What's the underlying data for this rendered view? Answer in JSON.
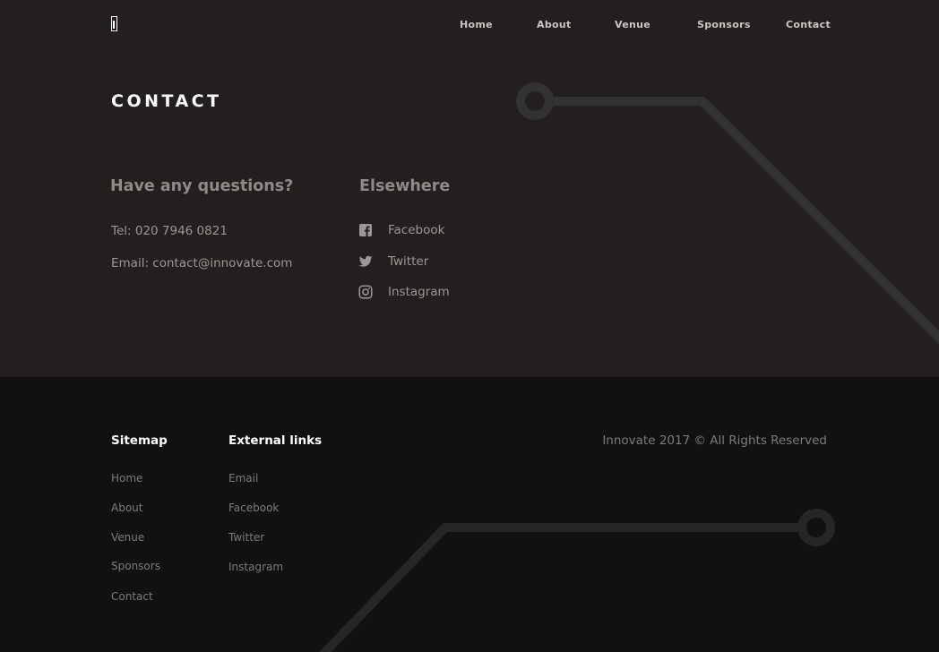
{
  "header": {
    "nav": [
      {
        "label": "Home"
      },
      {
        "label": "About"
      },
      {
        "label": "Venue"
      },
      {
        "label": "Sponsors"
      },
      {
        "label": "Contact"
      }
    ]
  },
  "contact": {
    "title": "CONTACT",
    "questions_heading": "Have any questions?",
    "tel": "Tel: 020 7946 0821",
    "email": "Email: contact@innovate.com",
    "elsewhere_heading": "Elsewhere",
    "social": [
      {
        "label": "Facebook",
        "icon": "facebook-icon"
      },
      {
        "label": "Twitter",
        "icon": "twitter-icon"
      },
      {
        "label": "Instagram",
        "icon": "instagram-icon"
      }
    ]
  },
  "footer": {
    "sitemap_heading": "Sitemap",
    "sitemap": [
      "Home",
      "About",
      "Venue",
      "Sponsors",
      "Contact"
    ],
    "external_heading": "External links",
    "external": [
      "Email",
      "Facebook",
      "Twitter",
      "Instagram"
    ],
    "copyright": "Innovate 2017 © All Rights Reserved"
  },
  "colors": {
    "top_background": "#231f1e",
    "footer_background": "#111111",
    "decoration": "#333333"
  }
}
